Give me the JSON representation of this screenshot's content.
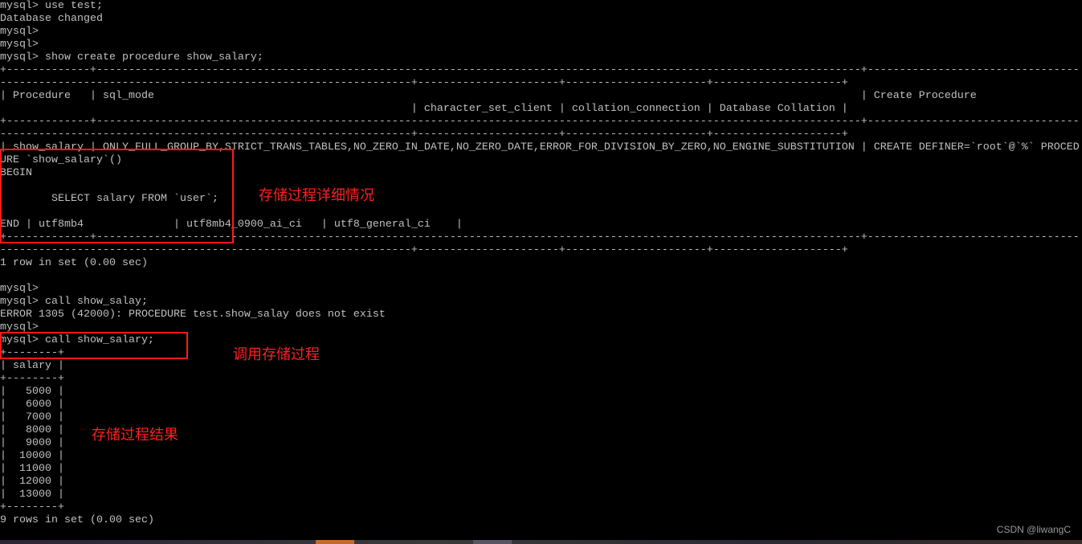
{
  "terminal": {
    "lines": [
      "mysql> use test;",
      "Database changed",
      "mysql>",
      "mysql>",
      "mysql> show create procedure show_salary;",
      "+-------------+-----------------------------------------------------------------------------------------------------------------------+---------------------------------",
      "----------------------------------------------------------------+----------------------+----------------------+--------------------+",
      "| Procedure   | sql_mode                                                                                                              | Create Procedure",
      "                                                                | character_set_client | collation_connection | Database Collation |",
      "+-------------+-----------------------------------------------------------------------------------------------------------------------+---------------------------------",
      "----------------------------------------------------------------+----------------------+----------------------+--------------------+",
      "| show_salary | ONLY_FULL_GROUP_BY,STRICT_TRANS_TABLES,NO_ZERO_IN_DATE,NO_ZERO_DATE,ERROR_FOR_DIVISION_BY_ZERO,NO_ENGINE_SUBSTITUTION | CREATE DEFINER=`root`@`%` PROCED",
      "URE `show_salary`()",
      "BEGIN",
      "",
      "        SELECT salary FROM `user`;",
      "",
      "END | utf8mb4              | utf8mb4_0900_ai_ci   | utf8_general_ci    |",
      "+-------------+-----------------------------------------------------------------------------------------------------------------------+---------------------------------",
      "----------------------------------------------------------------+----------------------+----------------------+--------------------+",
      "1 row in set (0.00 sec)",
      "",
      "mysql>",
      "mysql> call show_salay;",
      "ERROR 1305 (42000): PROCEDURE test.show_salay does not exist",
      "mysql>",
      "mysql> call show_salary;",
      "+--------+",
      "| salary |",
      "+--------+",
      "|   5000 |",
      "|   6000 |",
      "|   7000 |",
      "|   8000 |",
      "|   9000 |",
      "|  10000 |",
      "|  11000 |",
      "|  12000 |",
      "|  13000 |",
      "+--------+",
      "9 rows in set (0.00 sec)"
    ]
  },
  "annotations": {
    "procedure_detail": "存储过程详细情况",
    "call_procedure": "调用存储过程",
    "procedure_result": "存储过程结果",
    "color": "#ff1a1a"
  },
  "watermark": "CSDN @liwangC",
  "taskbar": {
    "active_color": "#c06a30",
    "item_color": "#5a5565"
  }
}
